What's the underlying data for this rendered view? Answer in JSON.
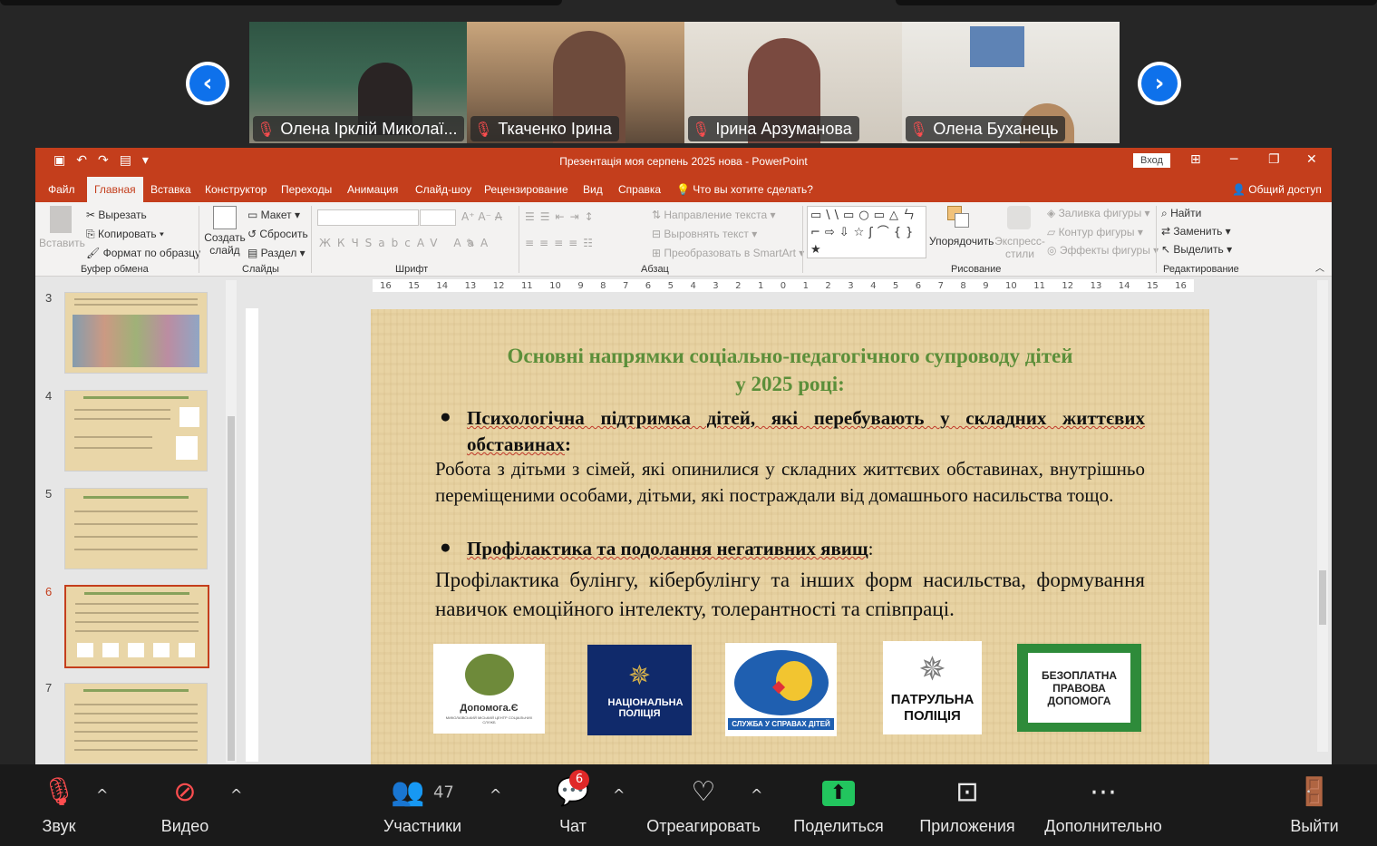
{
  "participants": [
    {
      "name": "Олена Ірклій Миколаї...",
      "bg": "#3d5a4a"
    },
    {
      "name": "Ткаченко Ірина",
      "bg": "#a98a6c"
    },
    {
      "name": "Ірина Арзуманова",
      "bg": "#d9d4cc"
    },
    {
      "name": "Олена Буханець",
      "bg": "#e4e2dd"
    }
  ],
  "ppt": {
    "window_title": "Презентація моя серпень 2025 нова - PowerPoint",
    "login": "Вход",
    "tabs": [
      "Файл",
      "Главная",
      "Вставка",
      "Конструктор",
      "Переходы",
      "Анимация",
      "Слайд-шоу",
      "Рецензирование",
      "Вид",
      "Справка",
      "Что вы хотите сделать?"
    ],
    "share": "Общий доступ",
    "ribbon": {
      "paste": "Вставить",
      "cut": "Вырезать",
      "copy": "Копировать",
      "format_painter": "Формат по образцу",
      "clipboard": "Буфер обмена",
      "new_slide": "Создать слайд",
      "layout": "Макет",
      "reset": "Сбросить",
      "section": "Раздел",
      "slides": "Слайды",
      "font": "Шрифт",
      "text_direction": "Направление текста",
      "align_text": "Выровнять текст",
      "smartart": "Преобразовать в SmartArt",
      "paragraph": "Абзац",
      "arrange": "Упорядочить",
      "quick_styles": "Экспресс-стили",
      "shape_fill": "Заливка фигуры",
      "shape_outline": "Контур фигуры",
      "shape_effects": "Эффекты фигуры",
      "drawing": "Рисование",
      "find": "Найти",
      "replace": "Заменить",
      "select": "Выделить",
      "editing": "Редактирование"
    },
    "thumb_numbers": [
      "3",
      "4",
      "5",
      "6",
      "7"
    ],
    "ruler_ticks": [
      "16",
      "15",
      "14",
      "13",
      "12",
      "11",
      "10",
      "9",
      "8",
      "7",
      "6",
      "5",
      "4",
      "3",
      "2",
      "1",
      "0",
      "1",
      "2",
      "3",
      "4",
      "5",
      "6",
      "7",
      "8",
      "9",
      "10",
      "11",
      "12",
      "13",
      "14",
      "15",
      "16"
    ],
    "slide": {
      "title_line1": "Основні напрямки соціально-педагогічного супроводу дітей",
      "title_line2": "у 2025 році:",
      "bullet1": "Психологічна підтримка дітей, які перебувають у складних життєвих обставинах",
      "bullet1_suffix": ":",
      "para1": "Робота з дітьми з сімей, які опинилися у складних життєвих обставинах, внутрішньо переміщеними особами, дітьми, які постраждали від домашнього насильства тощо.",
      "bullet2": "Профілактика та подолання негативних явищ",
      "bullet2_suffix": ":",
      "para2": "Профілактика булінгу, кібербулінгу та інших форм насильства, формування навичок емоційного інтелекту, толерантності та співпраці.",
      "logos": {
        "dopomoga": "Допомога.Є",
        "dopomoga_sub": "МИКОЛАЇВСЬКИЙ МІСЬКИЙ ЦЕНТР СОЦІАЛЬНИХ СЛУЖБ",
        "police": "НАЦІОНАЛЬНА ПОЛІЦІЯ",
        "children": "СЛУЖБА У СПРАВАХ ДІТЕЙ",
        "patrol": "ПАТРУЛЬНА ПОЛІЦІЯ",
        "legal": "БЕЗОПЛАТНА ПРАВОВА ДОПОМОГА"
      }
    }
  },
  "toolbar": {
    "audio": "Звук",
    "video": "Видео",
    "participants": "Участники",
    "participants_count": "47",
    "chat": "Чат",
    "chat_badge": "6",
    "react": "Отреагировать",
    "share": "Поделиться",
    "apps": "Приложения",
    "more": "Дополнительно",
    "leave": "Выйти"
  },
  "colors": {
    "ppt_accent": "#c43e1c",
    "zoom_blue": "#0e71eb",
    "share_green": "#22c55e",
    "slide_title": "#5c8f3a"
  }
}
